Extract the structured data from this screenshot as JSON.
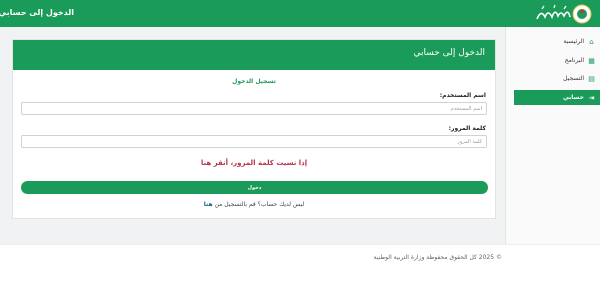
{
  "header": {
    "title": "الدخول إلى حسابي",
    "brand_color": "#1a9b5a"
  },
  "sidebar": {
    "items": [
      {
        "label": "الرئيسية",
        "icon": "home-icon"
      },
      {
        "label": "البرنامج",
        "icon": "calendar-icon"
      },
      {
        "label": "التسجيل",
        "icon": "document-icon"
      },
      {
        "label": "حسابي",
        "icon": "sign-in-icon",
        "active": true
      }
    ]
  },
  "login": {
    "card_title": "الدخول إلى حسابي",
    "section_title": "تسجيل الدخول",
    "username_label": "اسم المستخدم:",
    "username_placeholder": "اسم المستخدم",
    "password_label": "كلمة المرور:",
    "password_placeholder": "كلمة المرور",
    "forgot_text": "إذا نسيت كلمة المرور، أنقر هنا",
    "submit_label": "دخول",
    "register_prefix": "ليس لديك حساب؟ قم بالتسجيل من",
    "register_link": "هنا"
  },
  "footer": {
    "copyright": "© 2025 كل الحقوق محفوظة وزارة التربية الوطنية"
  }
}
